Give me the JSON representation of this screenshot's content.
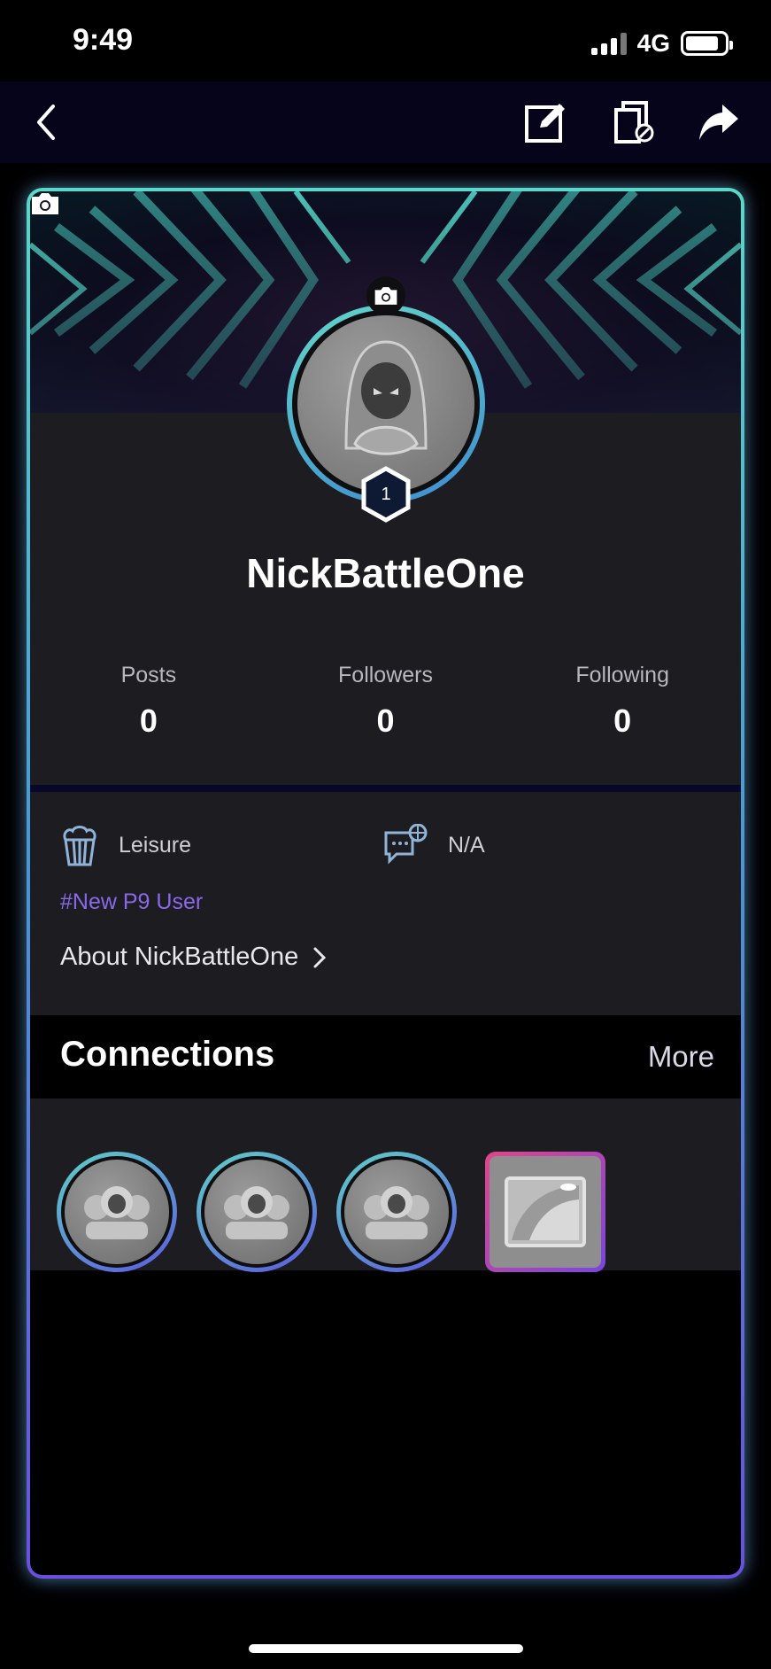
{
  "status_bar": {
    "time": "9:49",
    "network": "4G",
    "battery_level": 0.85
  },
  "nav": {
    "back": "back-icon",
    "edit": "edit-icon",
    "copy_link": "copy-link-icon",
    "share": "share-icon"
  },
  "profile": {
    "username": "NickBattleOne",
    "level": "1",
    "stats": [
      {
        "label": "Posts",
        "value": "0"
      },
      {
        "label": "Followers",
        "value": "0"
      },
      {
        "label": "Following",
        "value": "0"
      }
    ],
    "interest": "Leisure",
    "language": "N/A",
    "hashtag": "#New P9 User",
    "about_link": "About NickBattleOne"
  },
  "connections": {
    "title": "Connections",
    "more_label": "More",
    "items": [
      "group-avatar",
      "group-avatar",
      "group-avatar",
      "image-placeholder"
    ]
  },
  "colors": {
    "accent_teal": "#59d9c9",
    "accent_purple": "#6a4fe0",
    "hashtag": "#8a68ea",
    "panel": "#1c1c21"
  }
}
